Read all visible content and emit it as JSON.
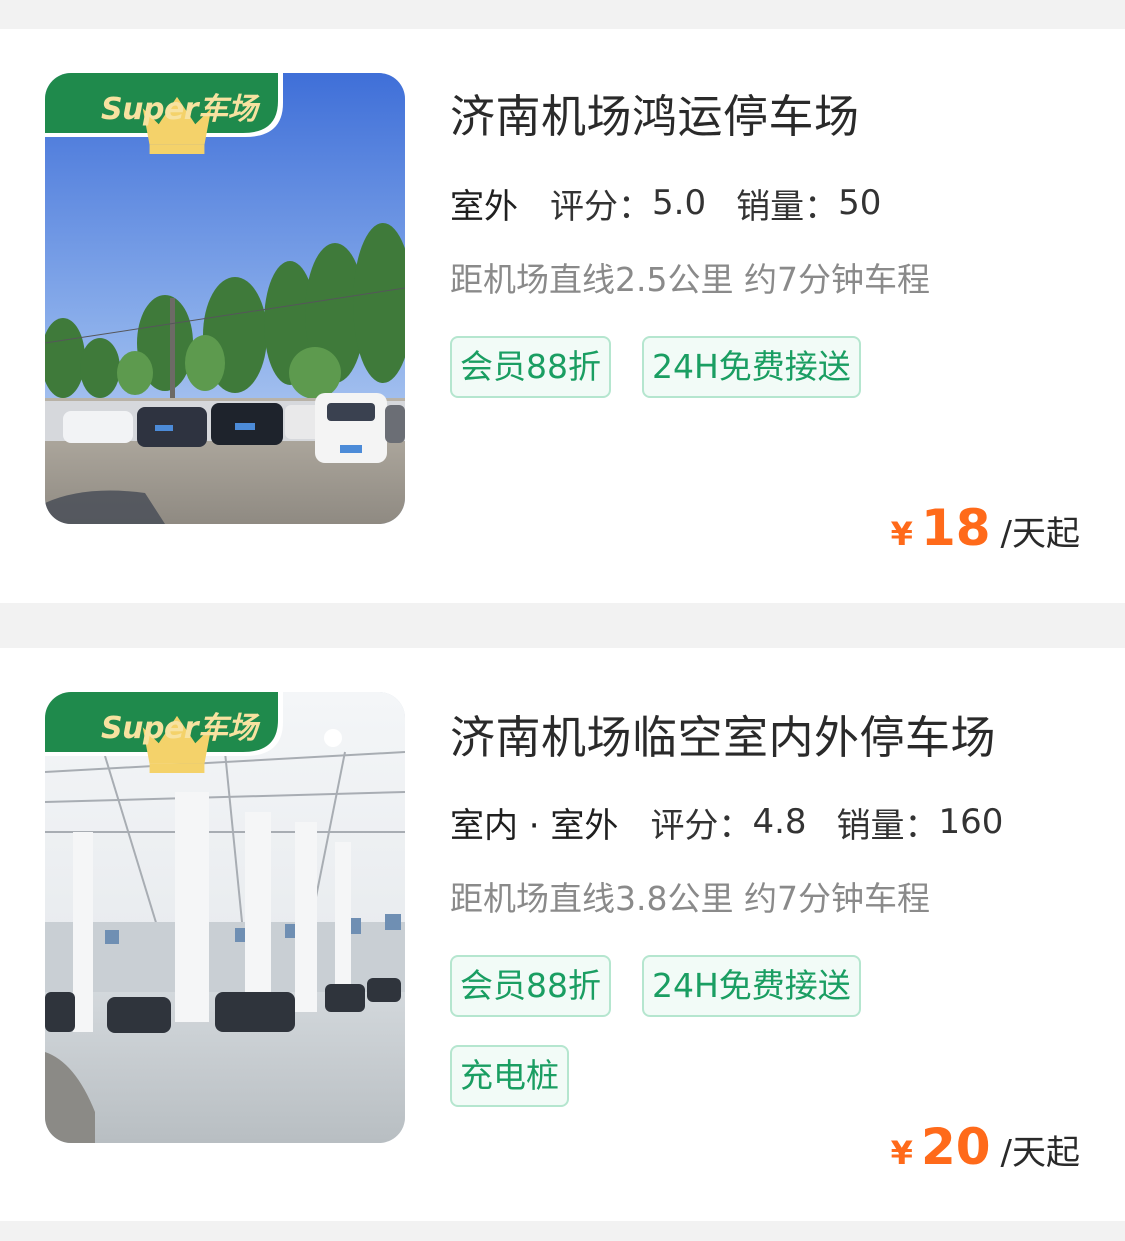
{
  "lots": [
    {
      "badge_text": "Super车场",
      "name": "济南机场鸿运停车场",
      "environment": "室外",
      "rating_label": "评分：",
      "rating": "5.0",
      "sales_label": "销量：",
      "sales": "50",
      "distance": "距机场直线2.5公里 约7分钟车程",
      "tags": [
        "会员88折",
        "24H免费接送"
      ],
      "currency": "¥",
      "price": "18",
      "price_unit": "/天起",
      "photo": "outdoor-parking-lot-photo"
    },
    {
      "badge_text": "Super车场",
      "name": "济南机场临空室内外停车场",
      "environment": "室内 · 室外",
      "rating_label": "评分：",
      "rating": "4.8",
      "sales_label": "销量：",
      "sales": "160",
      "distance": "距机场直线3.8公里 约7分钟车程",
      "tags": [
        "会员88折",
        "24H免费接送",
        "充电桩"
      ],
      "currency": "¥",
      "price": "20",
      "price_unit": "/天起",
      "photo": "indoor-parking-garage-photo"
    }
  ],
  "colors": {
    "page_background": "#f2f2f2",
    "badge_green": "#1f8a4c",
    "badge_text": "#f7e2a0",
    "tag_text": "#1a9e62",
    "tag_border": "#b5e6cf",
    "price": "#ff6a1a"
  }
}
